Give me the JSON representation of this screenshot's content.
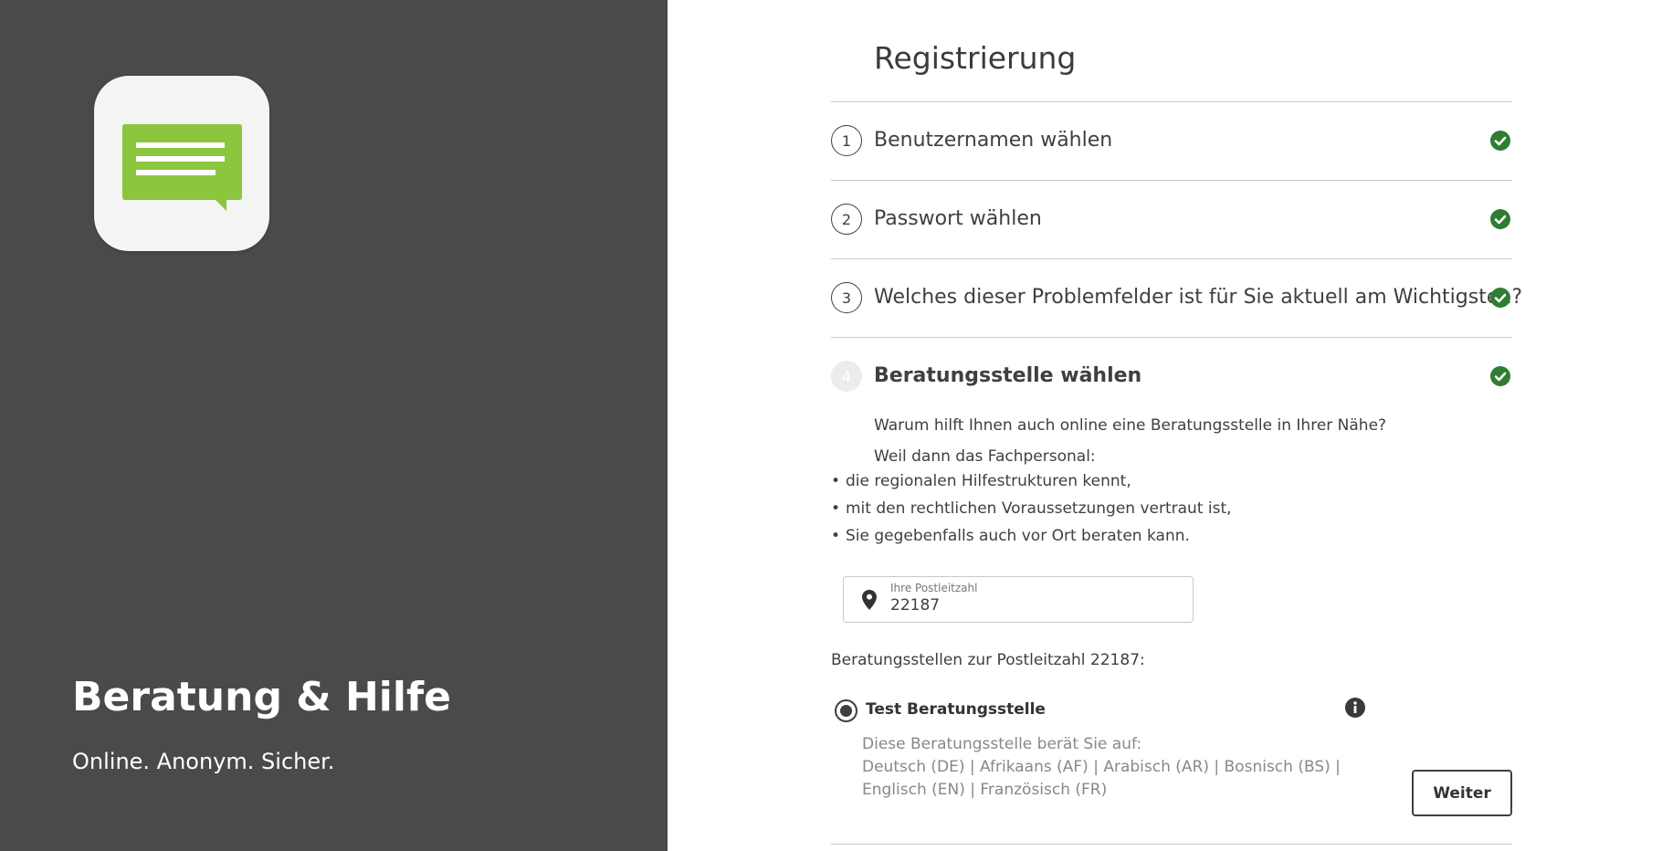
{
  "brand": {
    "title": "Beratung & Hilfe",
    "subtitle": "Online. Anonym. Sicher.",
    "icon": "chat-bubble-icon",
    "icon_color": "#8cc63e"
  },
  "registration": {
    "title": "Registrierung",
    "steps": [
      {
        "number": "1",
        "label": "Benutzernamen wählen",
        "completed": true
      },
      {
        "number": "2",
        "label": "Passwort wählen",
        "completed": true
      },
      {
        "number": "3",
        "label": "Welches dieser Problemfelder ist für Sie aktuell am Wichtigsten?",
        "completed": true
      },
      {
        "number": "4",
        "label": "Beratungsstelle wählen",
        "completed": true,
        "active": true
      }
    ],
    "check_color": "#2e7d32"
  },
  "agency_step": {
    "question": "Warum hilft Ihnen auch online eine Beratungsstelle in Ihrer Nähe?",
    "reason_intro": "Weil dann das Fachpersonal:",
    "reasons": [
      "die regionalen Hilfestrukturen kennt,",
      "mit den rechtlichen Voraussetzungen vertraut ist,",
      "Sie gegebenfalls auch vor Ort beraten kann."
    ],
    "zip": {
      "label": "Ihre Postleitzahl",
      "value": "22187"
    },
    "results_label": "Beratungsstellen zur Postleitzahl 22187:",
    "agency": {
      "name": "Test Beratungsstelle",
      "selected": true,
      "description": "Diese Beratungsstelle berät Sie auf:",
      "languages_line1": "Deutsch (DE)  |  Afrikaans (AF)  |  Arabisch (AR)  |  Bosnisch (BS)  |",
      "languages_line2": "Englisch (EN)  |  Französisch (FR)"
    },
    "next_button": "Weiter"
  }
}
